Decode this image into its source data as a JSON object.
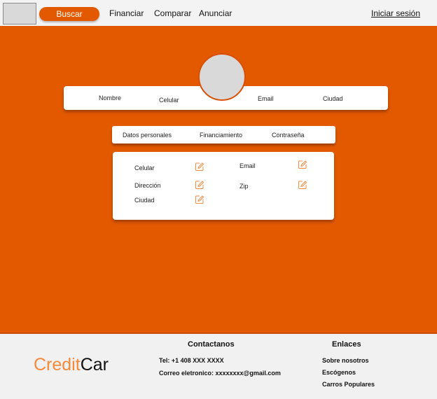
{
  "nav": {
    "buscar": "Buscar",
    "financiar": "Financiar",
    "comparar": "Comparar",
    "anunciar": "Anunciar",
    "login": "Iniciar sesión"
  },
  "profile": {
    "nombre": "Nombre",
    "celular": "Celular",
    "email": "Email",
    "ciudad": "Ciudad"
  },
  "tabs": [
    "Datos personales",
    "Financiamiento",
    "Contraseña"
  ],
  "card": {
    "celular": "Celular",
    "direccion": "Dirección",
    "ciudad": "Ciudad",
    "email": "Email",
    "zip": "Zip"
  },
  "footer": {
    "brand_a": "Credit",
    "brand_b": "Car",
    "contact_title": "Contactanos",
    "tel": "Tel: +1 408 XXX XXXX",
    "correo": "Correo eletronico: xxxxxxxx@gmail.com",
    "links_title": "Enlaces",
    "links": [
      "Sobre nosotros",
      "Escógenos",
      "Carros Populares"
    ]
  },
  "colors": {
    "accent": "#e35900",
    "brand_orange": "#f58a3b",
    "edit_icon": "#f58a3b"
  },
  "icons": {
    "edit": "pencil-square-icon"
  }
}
